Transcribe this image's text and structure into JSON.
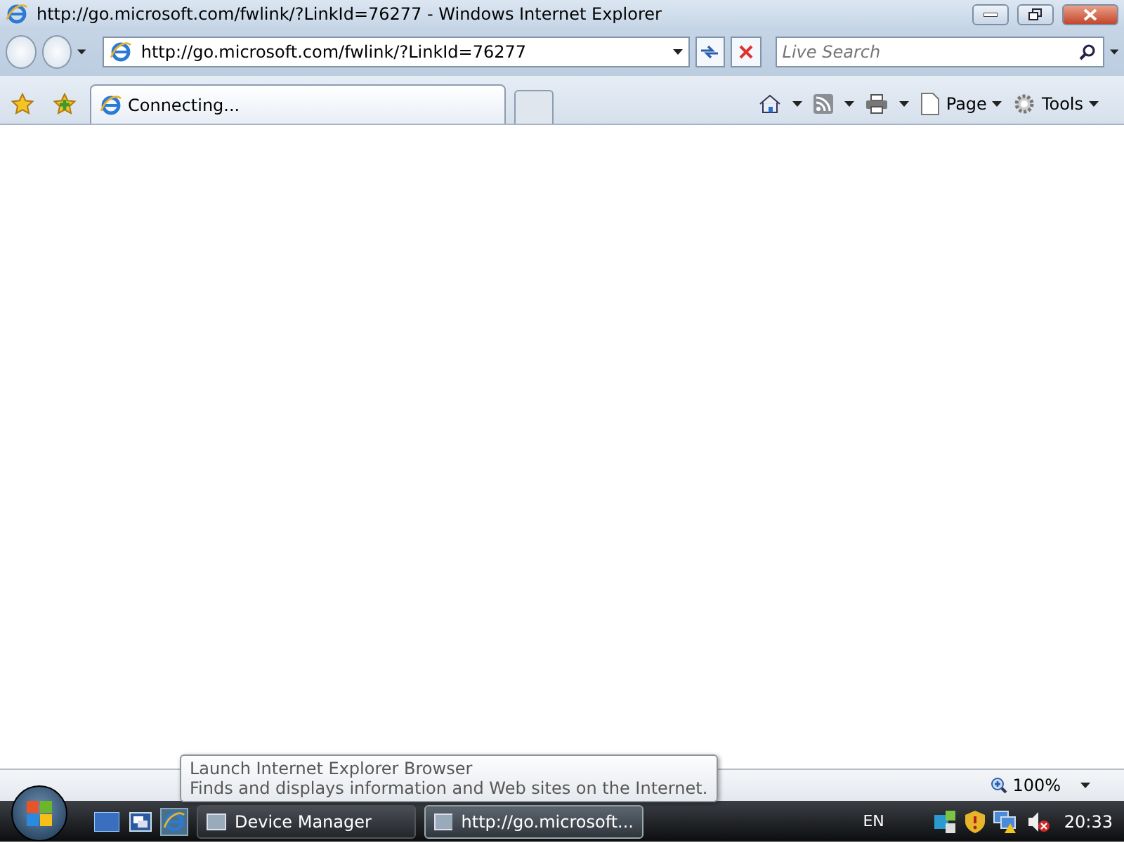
{
  "window": {
    "title": "http://go.microsoft.com/fwlink/?LinkId=76277 - Windows Internet Explorer"
  },
  "address_bar": {
    "value": "http://go.microsoft.com/fwlink/?LinkId=76277"
  },
  "search": {
    "placeholder": "Live Search"
  },
  "tabs": [
    {
      "label": "Connecting...",
      "selected": true
    }
  ],
  "command_bar": {
    "page": "Page",
    "tools": "Tools"
  },
  "status_bar": {
    "zoom": "100%"
  },
  "tooltip": {
    "title": "Launch Internet Explorer Browser",
    "text": "Finds and displays information and Web sites on the Internet."
  },
  "taskbar": {
    "buttons": [
      {
        "label": "Device Manager",
        "selected": false
      },
      {
        "label": "http://go.microsoft...",
        "selected": true
      }
    ],
    "language": "EN",
    "clock": "20:33"
  }
}
